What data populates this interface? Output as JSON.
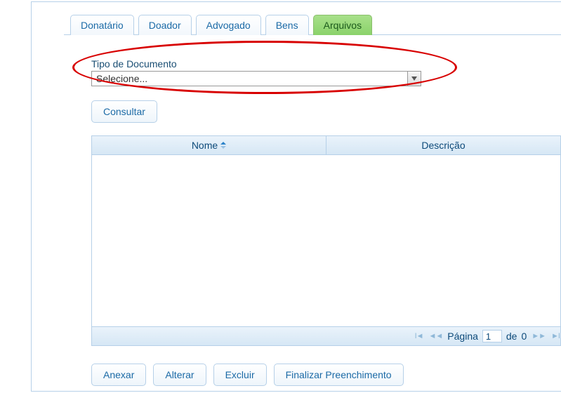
{
  "tabs": [
    {
      "label": "Donatário",
      "active": false
    },
    {
      "label": "Doador",
      "active": false
    },
    {
      "label": "Advogado",
      "active": false
    },
    {
      "label": "Bens",
      "active": false
    },
    {
      "label": "Arquivos",
      "active": true
    }
  ],
  "documento": {
    "label": "Tipo de Documento",
    "selected": "Selecione..."
  },
  "buttons": {
    "consultar": "Consultar",
    "anexar": "Anexar",
    "alterar": "Alterar",
    "excluir": "Excluir",
    "finalizar": "Finalizar Preenchimento"
  },
  "table": {
    "columns": [
      "Nome",
      "Descrição"
    ],
    "sort_column": 0,
    "rows": []
  },
  "pager": {
    "label_pagina": "Página",
    "current": "1",
    "label_de": "de",
    "total": "0"
  }
}
